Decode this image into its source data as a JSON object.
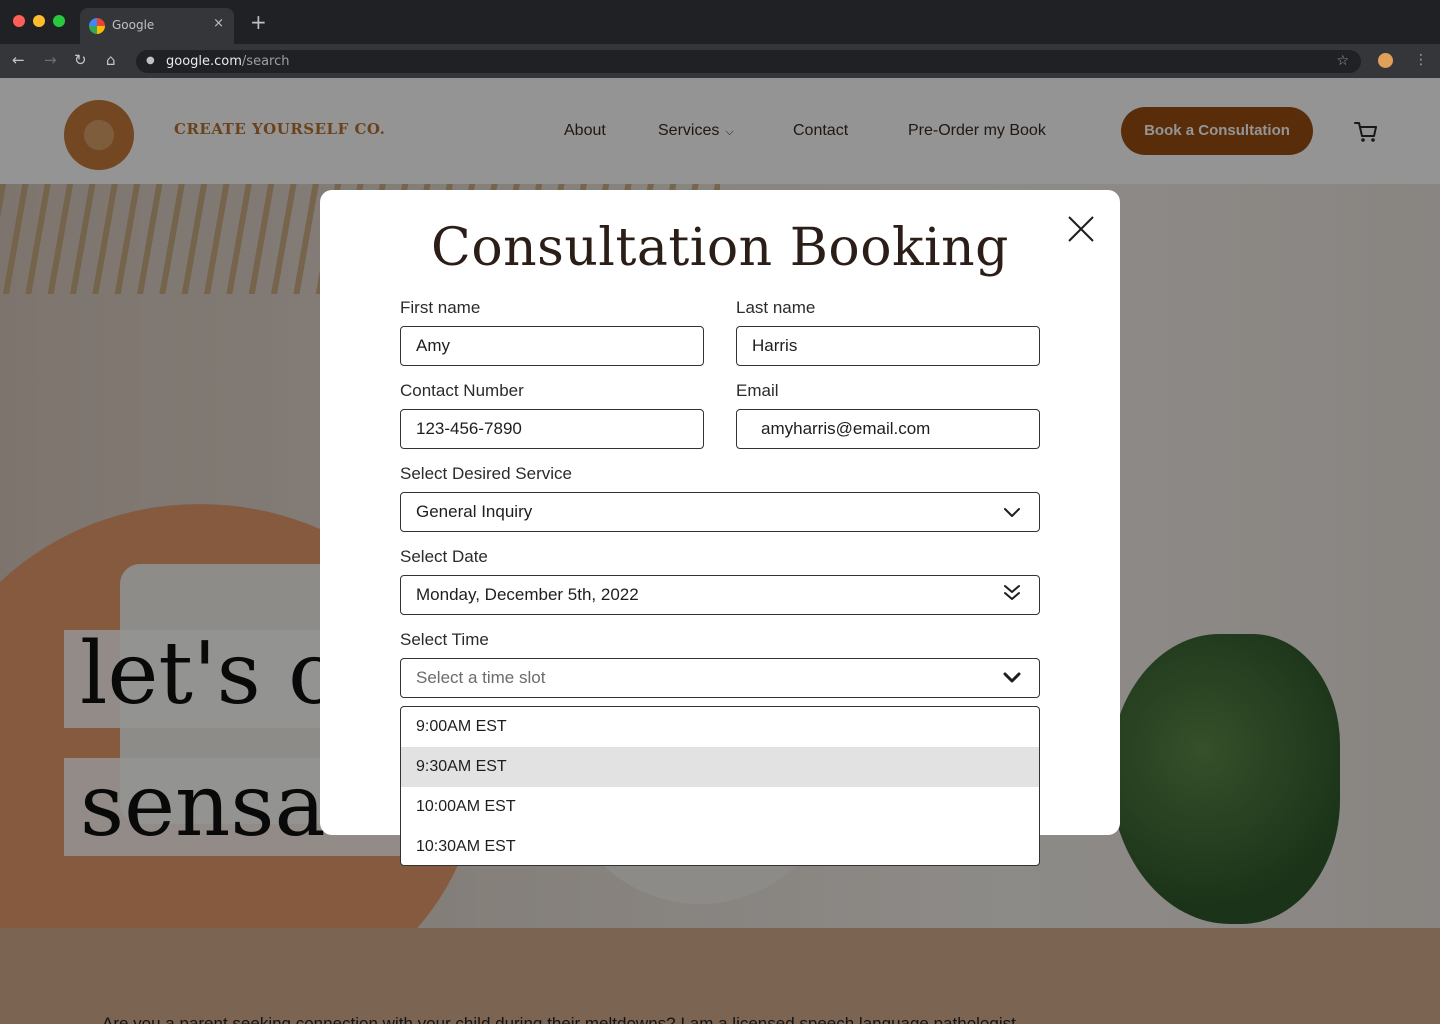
{
  "browser": {
    "tab_title": "Google",
    "tab_close": "×",
    "new_tab": "+",
    "url_host": "google.com",
    "url_path": "/search"
  },
  "site": {
    "brand": "CREATE YOURSELF CO.",
    "nav": {
      "about": "About",
      "services": "Services",
      "contact": "Contact",
      "preorder": "Pre-Order my Book"
    },
    "cta": "Book a Consultation",
    "hero_line1": "let's cr",
    "hero_line2": "sensa",
    "below_text": "Are you a parent seeking connection with your child during their meltdowns? I am a licensed speech language pathologist"
  },
  "modal": {
    "title": "Consultation Booking",
    "first_name": {
      "label": "First name",
      "value": "Amy"
    },
    "last_name": {
      "label": "Last name",
      "value": "Harris"
    },
    "contact_number": {
      "label": "Contact Number",
      "value": "123-456-7890"
    },
    "email": {
      "label": "Email",
      "value": "amyharris@email.com"
    },
    "service": {
      "label": "Select Desired Service",
      "value": "General Inquiry"
    },
    "date": {
      "label": "Select Date",
      "value": "Monday, December 5th, 2022"
    },
    "time": {
      "label": "Select Time",
      "placeholder": "Select a time slot",
      "options": [
        "9:00AM EST",
        "9:30AM EST",
        "10:00AM EST",
        "10:30AM EST"
      ],
      "hovered_option": "9:30AM EST"
    }
  },
  "colors": {
    "cta": "#9a4f10",
    "brand": "#b8732f",
    "title": "#2b1d17",
    "option_hover": "#e2e2e2"
  },
  "icons": [
    "lock-icon",
    "star-icon",
    "cart-icon",
    "close-icon",
    "chevron-down-icon",
    "double-chevron-down-icon"
  ]
}
